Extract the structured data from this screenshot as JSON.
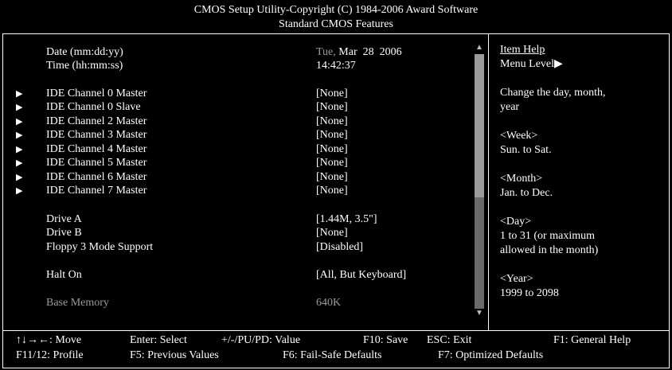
{
  "header": {
    "line1": "CMOS Setup Utility-Copyright (C) 1984-2006 Award Software",
    "line2": "Standard CMOS Features"
  },
  "settings": [
    {
      "label": "Date (mm:dd:yy)",
      "value": "Tue, Mar 28 2006",
      "arrow": ""
    },
    {
      "label": "Time (hh:mm:ss)",
      "value": "14:42:37",
      "arrow": ""
    },
    {
      "label": "IDE Channel 0 Master",
      "value": "[None]",
      "arrow": "▶"
    },
    {
      "label": "IDE Channel 0 Slave",
      "value": "[None]",
      "arrow": "▶"
    },
    {
      "label": "IDE Channel 2 Master",
      "value": "[None]",
      "arrow": "▶"
    },
    {
      "label": "IDE Channel 3 Master",
      "value": "[None]",
      "arrow": "▶"
    },
    {
      "label": "IDE Channel 4 Master",
      "value": "[None]",
      "arrow": "▶"
    },
    {
      "label": "IDE Channel 5 Master",
      "value": "[None]",
      "arrow": "▶"
    },
    {
      "label": "IDE Channel 6 Master",
      "value": "[None]",
      "arrow": "▶"
    },
    {
      "label": "IDE Channel 7 Master",
      "value": "[None]",
      "arrow": "▶"
    },
    {
      "label": "Drive A",
      "value": "[1.44M, 3.5\"]",
      "arrow": ""
    },
    {
      "label": "Drive B",
      "value": "[None]",
      "arrow": ""
    },
    {
      "label": "Floppy 3 Mode Support",
      "value": "[Disabled]",
      "arrow": ""
    },
    {
      "label": "Halt On",
      "value": "[All, But Keyboard]",
      "arrow": ""
    },
    {
      "label": "Base Memory",
      "value": "640K",
      "arrow": ""
    }
  ],
  "help": {
    "title": "Item Help",
    "menu_level": "Menu Level▶",
    "lines": [
      "Change the day, month,",
      "year",
      "<Week>",
      "Sun. to Sat.",
      "<Month>",
      "Jan. to Dec.",
      "<Day>",
      "1 to 31 (or maximum",
      "allowed in the month)",
      "<Year>",
      "1999 to 2098"
    ]
  },
  "footer": {
    "move": "↑↓→←: Move",
    "enter": "Enter: Select",
    "value": "+/-/PU/PD: Value",
    "f10": "F10: Save",
    "esc": "ESC: Exit",
    "f1": "F1: General Help",
    "f11": "F11/12: Profile",
    "f5": "F5: Previous Values",
    "f6": "F6: Fail-Safe Defaults",
    "f7": "F7: Optimized Defaults"
  }
}
